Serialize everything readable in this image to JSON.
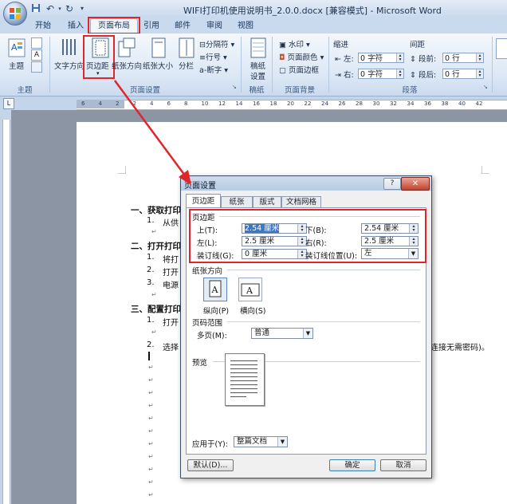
{
  "window": {
    "title": "WIFI打印机使用说明书_2.0.0.docx [兼容模式] - Microsoft Word"
  },
  "quick_access": {
    "save_icon": "save-icon",
    "undo_icon": "undo-icon",
    "redo_icon": "redo-icon"
  },
  "tabs": [
    "开始",
    "插入",
    "页面布局",
    "引用",
    "邮件",
    "审阅",
    "视图"
  ],
  "ribbon": {
    "groups": {
      "theme": "主题",
      "page_setup": "页面设置",
      "draft": "稿纸",
      "page_background": "页面背景",
      "paragraph": "段落"
    },
    "theme_btn": "主题",
    "text_dir": "文字方向",
    "margins": "页边距",
    "orientation": "纸张方向",
    "size": "纸张大小",
    "columns": "分栏",
    "breaks": "分隔符",
    "line_numbers": "行号",
    "hyphenation": "断字",
    "draft_setting_1": "稿纸",
    "draft_setting_2": "设置",
    "watermark": "水印",
    "page_color": "页面颜色",
    "page_border": "页面边框",
    "indent_title": "缩进",
    "indent_left_label": "左:",
    "indent_left_val": "0 字符",
    "indent_right_label": "右:",
    "indent_right_val": "0 字符",
    "spacing_title": "间距",
    "spacing_before_label": "段前:",
    "spacing_before_val": "0 行",
    "spacing_after_label": "段后:",
    "spacing_after_val": "0 行"
  },
  "ruler": {
    "ticks": [
      "6",
      "4",
      "2",
      "2",
      "4",
      "6",
      "8",
      "10",
      "12",
      "14",
      "16",
      "18",
      "20",
      "22",
      "24",
      "26",
      "28",
      "30",
      "32",
      "34",
      "36",
      "38",
      "40",
      "42"
    ]
  },
  "document": {
    "h1": "一、获取打印",
    "item1_1_num": "1.",
    "item1_1": "从供",
    "h2": "二、打开打印",
    "item2_1_num": "1.",
    "item2_1": "将打",
    "item2_2_num": "2.",
    "item2_2": "打开",
    "item2_3_num": "3.",
    "item2_3": "电源",
    "h3": "三、配置打印",
    "item3_1_num": "1.",
    "item3_1": "打开",
    "item3_2_num": "2.",
    "item3_2": "选择",
    "item3_2_tail": "连接无需密码)。",
    "para_mark": "↵"
  },
  "dialog": {
    "title": "页面设置",
    "help": "?",
    "close": "✕",
    "tabs": [
      "页边距",
      "纸张",
      "版式",
      "文档网格"
    ],
    "margins_section": "页边距",
    "top_label": "上(T):",
    "top_val": "2.54 厘米",
    "bottom_label": "下(B):",
    "bottom_val": "2.54 厘米",
    "left_label": "左(L):",
    "left_val": "2.5 厘米",
    "right_label": "右(R):",
    "right_val": "2.5 厘米",
    "gutter_label": "装订线(G):",
    "gutter_val": "0 厘米",
    "gutter_pos_label": "装订线位置(U):",
    "gutter_pos_val": "左",
    "orientation_section": "纸张方向",
    "portrait": "纵向(P)",
    "landscape": "横向(S)",
    "pages_section": "页码范围",
    "multiple_pages_label": "多页(M):",
    "multiple_pages_val": "普通",
    "preview_section": "预览",
    "apply_to_label": "应用于(Y):",
    "apply_to_val": "整篇文档",
    "default_btn": "默认(D)...",
    "ok_btn": "确定",
    "cancel_btn": "取消"
  },
  "colors": {
    "highlight_red": "#e0262a",
    "ribbon_blue": "#dbe7f5"
  }
}
